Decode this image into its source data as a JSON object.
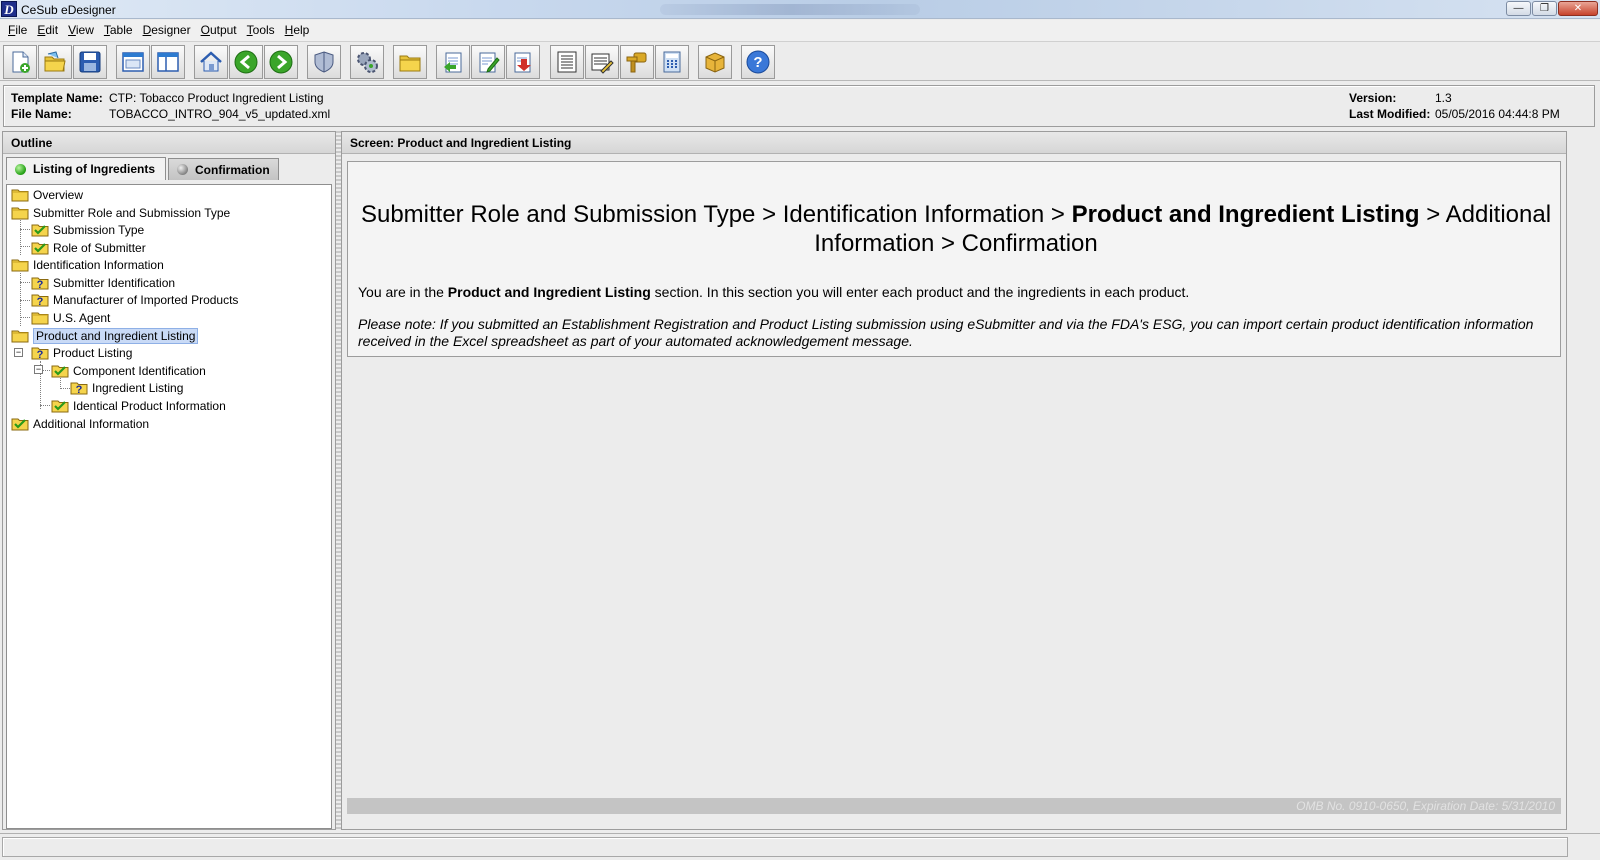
{
  "window": {
    "title": "CeSub eDesigner",
    "app_icon_letter": "D"
  },
  "menu": [
    {
      "u": "F",
      "rest": "ile"
    },
    {
      "u": "E",
      "rest": "dit"
    },
    {
      "u": "V",
      "rest": "iew"
    },
    {
      "u": "T",
      "rest": "able"
    },
    {
      "u": "D",
      "rest": "esigner"
    },
    {
      "u": "O",
      "rest": "utput"
    },
    {
      "u": "T",
      "rest": "ools"
    },
    {
      "u": "H",
      "rest": "elp"
    }
  ],
  "toolbar": {
    "icons": [
      "new-file-icon",
      "open-folder-icon",
      "save-icon",
      "window-icon",
      "split-view-icon",
      "home-icon",
      "back-arrow-icon",
      "forward-arrow-icon",
      "shield-icon",
      "settings-gears-icon",
      "folder-icon",
      "import-icon",
      "edit-icon",
      "export-icon",
      "list-icon",
      "properties-icon",
      "key-icon",
      "calculator-icon",
      "package-icon",
      "help-icon"
    ]
  },
  "info": {
    "template_label": "Template Name:",
    "template_value": "CTP: Tobacco Product Ingredient Listing",
    "file_label": "File Name:",
    "file_value": "TOBACCO_INTRO_904_v5_updated.xml",
    "version_label": "Version:",
    "version_value": "1.3",
    "modified_label": "Last Modified:",
    "modified_value": "05/05/2016 04:44:8 PM"
  },
  "outline": {
    "title": "Outline",
    "tabs": [
      {
        "label": "Listing of Ingredients",
        "status": "green"
      },
      {
        "label": "Confirmation",
        "status": "gray"
      }
    ],
    "tree": [
      {
        "label": "Overview",
        "icon": "folder"
      },
      {
        "label": "Submitter Role and Submission Type",
        "icon": "folder"
      },
      {
        "label": "Submission Type",
        "icon": "check"
      },
      {
        "label": "Role of Submitter",
        "icon": "check"
      },
      {
        "label": "Identification Information",
        "icon": "folder"
      },
      {
        "label": "Submitter Identification",
        "icon": "question"
      },
      {
        "label": "Manufacturer of Imported Products",
        "icon": "question"
      },
      {
        "label": "U.S. Agent",
        "icon": "folder"
      },
      {
        "label": "Product and Ingredient Listing",
        "icon": "folder"
      },
      {
        "label": "Product Listing",
        "icon": "question"
      },
      {
        "label": "Component Identification",
        "icon": "check"
      },
      {
        "label": "Ingredient Listing",
        "icon": "question"
      },
      {
        "label": "Identical Product Information",
        "icon": "check"
      },
      {
        "label": "Additional Information",
        "icon": "check"
      }
    ]
  },
  "screen": {
    "title": "Screen: Product and Ingredient Listing",
    "crumb1": "Submitter Role and Submission Type > Identification Information > ",
    "crumb_current": "Product and Ingredient Listing",
    "crumb2": " > Additional Information > Confirmation",
    "intro_pre": "You are in the ",
    "intro_bold": "Product and Ingredient Listing",
    "intro_post": " section. In this section you will enter each product and the ingredients in each product.",
    "note": "Please note: If you submitted an Establishment Registration and Product Listing submission using eSubmitter and via the FDA's ESG, you can import certain product identification information received in the Excel spreadsheet as part of your automated acknowledgement message.",
    "omb": "OMB No. 0910-0650, Expiration Date: 5/31/2010"
  },
  "colors": {
    "selection": "#c9daf6",
    "folder": "#f5d44c",
    "check": "#2a9a1a"
  }
}
